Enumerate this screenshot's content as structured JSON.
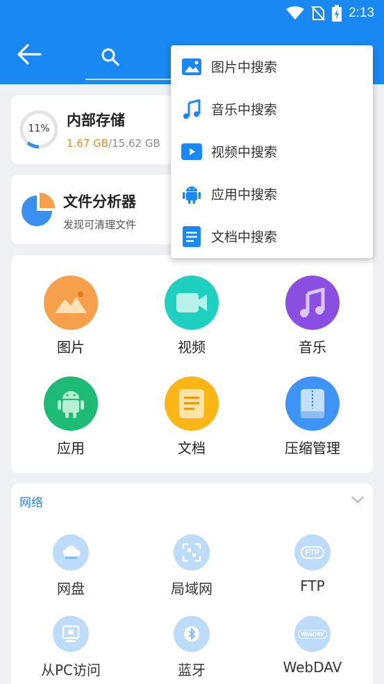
{
  "status_bar": {
    "time": "2:13"
  },
  "storage": {
    "title": "内部存储",
    "percent_label": "11%",
    "percent": 11,
    "used": "1.67 GB",
    "separator": "/",
    "total": "15.62 GB"
  },
  "analyzer": {
    "title": "文件分析器",
    "subtitle": "发现可清理文件"
  },
  "categories": [
    {
      "label": "图片",
      "icon": "image-icon",
      "color": "#f7a04b"
    },
    {
      "label": "视频",
      "icon": "video-icon",
      "color": "#1fcfbf"
    },
    {
      "label": "音乐",
      "icon": "music-icon",
      "color": "#8a4fe0"
    },
    {
      "label": "应用",
      "icon": "android-icon",
      "color": "#1dbb76"
    },
    {
      "label": "文档",
      "icon": "document-icon",
      "color": "#fbb514"
    },
    {
      "label": "压缩管理",
      "icon": "archive-icon",
      "color": "#3d94f6"
    }
  ],
  "network": {
    "title": "网络",
    "items": [
      {
        "label": "网盘",
        "icon": "cloud-icon"
      },
      {
        "label": "局域网",
        "icon": "lan-icon"
      },
      {
        "label": "FTP",
        "icon": "ftp-icon",
        "icon_text": "FTP"
      },
      {
        "label": "从PC访问",
        "icon": "pc-icon"
      },
      {
        "label": "蓝牙",
        "icon": "bluetooth-icon"
      },
      {
        "label": "WebDAV",
        "icon": "webdav-icon",
        "icon_text": "WebDAV"
      }
    ]
  },
  "search_menu": {
    "items": [
      {
        "label": "图片中搜索",
        "icon": "image-icon"
      },
      {
        "label": "音乐中搜索",
        "icon": "music-note-icon"
      },
      {
        "label": "视频中搜索",
        "icon": "video-play-icon"
      },
      {
        "label": "应用中搜索",
        "icon": "android-icon"
      },
      {
        "label": "文档中搜索",
        "icon": "document-icon"
      }
    ]
  },
  "colors": {
    "primary": "#1a88f2",
    "accent_orange": "#f08a24"
  }
}
